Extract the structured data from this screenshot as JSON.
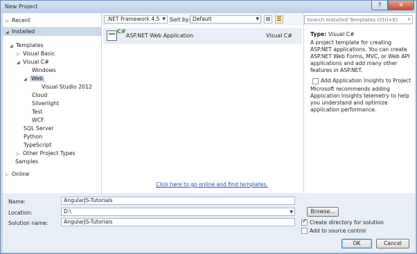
{
  "window": {
    "title": "New Project",
    "help_glyph": "?",
    "close_glyph": "✕"
  },
  "tree": {
    "recent": "Recent",
    "installed": "Installed",
    "templates": "Templates",
    "visual_basic": "Visual Basic",
    "visual_csharp": "Visual C#",
    "windows": "Windows",
    "web": "Web",
    "vs2012": "Visual Studio 2012",
    "cloud": "Cloud",
    "silverlight": "Silverlight",
    "test": "Test",
    "wcf": "WCF",
    "sql_server": "SQL Server",
    "python": "Python",
    "typescript": "TypeScript",
    "other_types": "Other Project Types",
    "samples": "Samples",
    "online": "Online"
  },
  "toolbar": {
    "framework": ".NET Framework 4.5",
    "sort_label": "Sort by:",
    "sort_value": "Default"
  },
  "template": {
    "name": "ASP.NET Web Application",
    "language": "Visual C#"
  },
  "online_link": "Click here to go online and find templates.",
  "details": {
    "search_placeholder": "Search Installed Templates (Ctrl+E)",
    "type_label": "Type:",
    "type_value": "Visual C#",
    "description": "A project template for creating ASP.NET applications. You can create ASP.NET Web Forms, MVC,  or Web API applications and add many other features in ASP.NET.",
    "insights_label": "Add Application Insights to Project",
    "insights_checked": false,
    "insights_desc": "Microsoft recommends adding Application Insights telemetry to help you understand and optimize application performance."
  },
  "form": {
    "name_label": "Name:",
    "name_value": "AngularJS-Tutorials",
    "location_label": "Location:",
    "location_value": "D:\\",
    "solution_label": "Solution name:",
    "solution_value": "AngularJS-Tutorials",
    "browse": "Browse...",
    "create_dir": "Create directory for solution",
    "create_dir_checked": true,
    "source_control": "Add to source control",
    "source_control_checked": false,
    "ok": "OK",
    "cancel": "Cancel"
  }
}
